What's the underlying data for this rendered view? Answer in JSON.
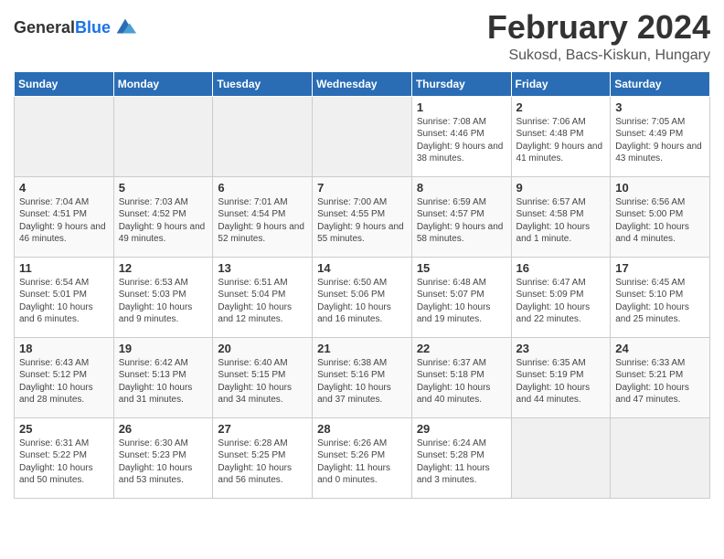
{
  "header": {
    "logo_general": "General",
    "logo_blue": "Blue",
    "month_title": "February 2024",
    "location": "Sukosd, Bacs-Kiskun, Hungary"
  },
  "days_of_week": [
    "Sunday",
    "Monday",
    "Tuesday",
    "Wednesday",
    "Thursday",
    "Friday",
    "Saturday"
  ],
  "weeks": [
    [
      {
        "day": "",
        "info": ""
      },
      {
        "day": "",
        "info": ""
      },
      {
        "day": "",
        "info": ""
      },
      {
        "day": "",
        "info": ""
      },
      {
        "day": "1",
        "info": "Sunrise: 7:08 AM\nSunset: 4:46 PM\nDaylight: 9 hours and 38 minutes."
      },
      {
        "day": "2",
        "info": "Sunrise: 7:06 AM\nSunset: 4:48 PM\nDaylight: 9 hours and 41 minutes."
      },
      {
        "day": "3",
        "info": "Sunrise: 7:05 AM\nSunset: 4:49 PM\nDaylight: 9 hours and 43 minutes."
      }
    ],
    [
      {
        "day": "4",
        "info": "Sunrise: 7:04 AM\nSunset: 4:51 PM\nDaylight: 9 hours and 46 minutes."
      },
      {
        "day": "5",
        "info": "Sunrise: 7:03 AM\nSunset: 4:52 PM\nDaylight: 9 hours and 49 minutes."
      },
      {
        "day": "6",
        "info": "Sunrise: 7:01 AM\nSunset: 4:54 PM\nDaylight: 9 hours and 52 minutes."
      },
      {
        "day": "7",
        "info": "Sunrise: 7:00 AM\nSunset: 4:55 PM\nDaylight: 9 hours and 55 minutes."
      },
      {
        "day": "8",
        "info": "Sunrise: 6:59 AM\nSunset: 4:57 PM\nDaylight: 9 hours and 58 minutes."
      },
      {
        "day": "9",
        "info": "Sunrise: 6:57 AM\nSunset: 4:58 PM\nDaylight: 10 hours and 1 minute."
      },
      {
        "day": "10",
        "info": "Sunrise: 6:56 AM\nSunset: 5:00 PM\nDaylight: 10 hours and 4 minutes."
      }
    ],
    [
      {
        "day": "11",
        "info": "Sunrise: 6:54 AM\nSunset: 5:01 PM\nDaylight: 10 hours and 6 minutes."
      },
      {
        "day": "12",
        "info": "Sunrise: 6:53 AM\nSunset: 5:03 PM\nDaylight: 10 hours and 9 minutes."
      },
      {
        "day": "13",
        "info": "Sunrise: 6:51 AM\nSunset: 5:04 PM\nDaylight: 10 hours and 12 minutes."
      },
      {
        "day": "14",
        "info": "Sunrise: 6:50 AM\nSunset: 5:06 PM\nDaylight: 10 hours and 16 minutes."
      },
      {
        "day": "15",
        "info": "Sunrise: 6:48 AM\nSunset: 5:07 PM\nDaylight: 10 hours and 19 minutes."
      },
      {
        "day": "16",
        "info": "Sunrise: 6:47 AM\nSunset: 5:09 PM\nDaylight: 10 hours and 22 minutes."
      },
      {
        "day": "17",
        "info": "Sunrise: 6:45 AM\nSunset: 5:10 PM\nDaylight: 10 hours and 25 minutes."
      }
    ],
    [
      {
        "day": "18",
        "info": "Sunrise: 6:43 AM\nSunset: 5:12 PM\nDaylight: 10 hours and 28 minutes."
      },
      {
        "day": "19",
        "info": "Sunrise: 6:42 AM\nSunset: 5:13 PM\nDaylight: 10 hours and 31 minutes."
      },
      {
        "day": "20",
        "info": "Sunrise: 6:40 AM\nSunset: 5:15 PM\nDaylight: 10 hours and 34 minutes."
      },
      {
        "day": "21",
        "info": "Sunrise: 6:38 AM\nSunset: 5:16 PM\nDaylight: 10 hours and 37 minutes."
      },
      {
        "day": "22",
        "info": "Sunrise: 6:37 AM\nSunset: 5:18 PM\nDaylight: 10 hours and 40 minutes."
      },
      {
        "day": "23",
        "info": "Sunrise: 6:35 AM\nSunset: 5:19 PM\nDaylight: 10 hours and 44 minutes."
      },
      {
        "day": "24",
        "info": "Sunrise: 6:33 AM\nSunset: 5:21 PM\nDaylight: 10 hours and 47 minutes."
      }
    ],
    [
      {
        "day": "25",
        "info": "Sunrise: 6:31 AM\nSunset: 5:22 PM\nDaylight: 10 hours and 50 minutes."
      },
      {
        "day": "26",
        "info": "Sunrise: 6:30 AM\nSunset: 5:23 PM\nDaylight: 10 hours and 53 minutes."
      },
      {
        "day": "27",
        "info": "Sunrise: 6:28 AM\nSunset: 5:25 PM\nDaylight: 10 hours and 56 minutes."
      },
      {
        "day": "28",
        "info": "Sunrise: 6:26 AM\nSunset: 5:26 PM\nDaylight: 11 hours and 0 minutes."
      },
      {
        "day": "29",
        "info": "Sunrise: 6:24 AM\nSunset: 5:28 PM\nDaylight: 11 hours and 3 minutes."
      },
      {
        "day": "",
        "info": ""
      },
      {
        "day": "",
        "info": ""
      }
    ]
  ]
}
